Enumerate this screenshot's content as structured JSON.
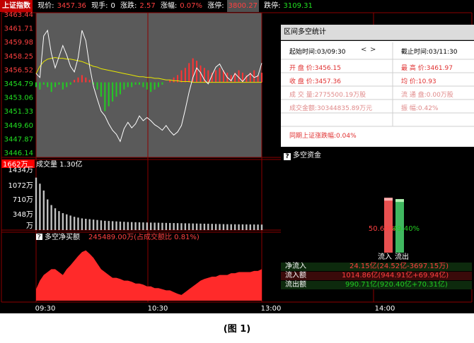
{
  "header": {
    "index_name": "上证指数",
    "current_label": "现价:",
    "current_value": "3457.36",
    "volume_label": "现手:",
    "volume_value": "0",
    "change_label": "涨跌:",
    "change_value": "2.57",
    "pct_label": "涨幅:",
    "pct_value": "0.07%",
    "limit_up_label": "涨停:",
    "limit_up_value": "3800.27",
    "limit_down_label": "跌停:",
    "limit_down_value": "3109.31"
  },
  "price_axis": {
    "ticks": [
      "3463.44",
      "3461.71",
      "3459.98",
      "3458.25",
      "3456.52",
      "3454.79",
      "3453.06",
      "3451.33",
      "3449.60",
      "3447.87",
      "3446.14"
    ]
  },
  "volume_panel": {
    "badge": "1662万",
    "title": "成交量 1.30亿",
    "ticks": [
      "1434万",
      "1072万",
      "710万",
      "348万",
      "万"
    ]
  },
  "net_panel": {
    "title_icon": "?",
    "title": "多空净买额",
    "title_value": "245489.00万(占成交额比 0.81%)"
  },
  "time_axis": {
    "labels": [
      "09:30",
      "10:30",
      "13:00",
      "14:00"
    ]
  },
  "popup": {
    "title": "区间多空统计",
    "start_time": "起始时间:03/09:30",
    "nav_prev": "<",
    "nav_next": ">",
    "end_time": "截止时间:03/11:30",
    "open": "开 盘 价:3456.15",
    "high": "最 高 价:3461.97",
    "close": "收 盘 价:3457.36",
    "avg": "均   价:10.93",
    "volume": "成 交 量:2775500.19万股",
    "float": "流 通 盘:0.00万股",
    "amount": "成交金额:30344835.89万元",
    "amplitude": "振   幅:0.42%",
    "change": "同期上证涨跌幅:0.04%",
    "section_title": "多空资金",
    "section_icon": "?",
    "bar_in_pct": "50.60%",
    "bar_out_pct": "49.40%",
    "bar_in_value": 50.6,
    "bar_out_value": 49.4,
    "bar_in_label": "流入",
    "bar_out_label": "流出",
    "rows": [
      {
        "label": "净流入",
        "value": "24.15亿(24.52亿-3697.15万)"
      },
      {
        "label": "流入额",
        "value": "1014.86亿(944.91亿+69.94亿)"
      },
      {
        "label": "流出额",
        "value": "990.71亿(920.40亿+70.31亿)"
      }
    ]
  },
  "figure_caption": "(图 1)",
  "colors": {
    "up": "#ff3333",
    "down": "#22cc22",
    "price_line": "#ffffff",
    "avg_line": "#e8e800",
    "grid": "#8b0000",
    "panel_bg": "#5a5a5a",
    "net_fill": "#ff2a2a",
    "bar_in": "#e85050",
    "bar_out": "#40b860"
  },
  "series": {
    "price": [
      3456.1,
      3455.6,
      3460.8,
      3461.5,
      3458.6,
      3456.8,
      3458.2,
      3459.6,
      3458.4,
      3457.0,
      3456.3,
      3458.1,
      3461.5,
      3460.2,
      3457.0,
      3454.5,
      3452.9,
      3451.4,
      3450.8,
      3449.8,
      3449.0,
      3448.5,
      3447.6,
      3449.2,
      3450.0,
      3449.3,
      3449.8,
      3450.8,
      3450.2,
      3450.6,
      3450.2,
      3449.7,
      3449.4,
      3449.0,
      3449.6,
      3448.9,
      3448.4,
      3448.8,
      3449.6,
      3451.6,
      3453.8,
      3455.6,
      3456.8,
      3456.2,
      3455.3,
      3454.8,
      3455.9,
      3456.9,
      3457.3,
      3456.4,
      3455.6,
      3455.2,
      3456.1,
      3455.6,
      3455.1,
      3455.7,
      3456.1,
      3455.6,
      3455.8,
      3457.4
    ],
    "avg": [
      3456.1,
      3457.0,
      3457.6,
      3457.9,
      3458.0,
      3458.1,
      3458.0,
      3458.0,
      3457.9,
      3457.9,
      3457.8,
      3457.7,
      3457.6,
      3457.4,
      3457.2,
      3457.0,
      3456.9,
      3456.7,
      3456.6,
      3456.5,
      3456.4,
      3456.3,
      3456.2,
      3456.1,
      3456.0,
      3455.9,
      3455.8,
      3455.7,
      3455.7,
      3455.6,
      3455.6,
      3455.5,
      3455.5,
      3455.4,
      3455.3,
      3455.3,
      3455.2,
      3455.2,
      3455.1,
      3455.1,
      3455.1,
      3455.0,
      3455.0,
      3455.0,
      3455.0,
      3455.0,
      3455.0,
      3455.0,
      3455.0,
      3455.0,
      3455.0,
      3455.0,
      3455.0,
      3455.0,
      3455.0,
      3455.0,
      3455.0,
      3455.0,
      3455.0,
      3455.0
    ],
    "volume": [
      1300,
      1150,
      980,
      760,
      620,
      540,
      470,
      420,
      390,
      360,
      330,
      310,
      290,
      280,
      270,
      260,
      250,
      240,
      230,
      225,
      220,
      215,
      210,
      205,
      200,
      198,
      195,
      192,
      190,
      188,
      186,
      184,
      182,
      180,
      178,
      176,
      174,
      172,
      170,
      168,
      166,
      164,
      162,
      160,
      158,
      156,
      154,
      152,
      150,
      148,
      146,
      145,
      144,
      143,
      142,
      141,
      140,
      139,
      138,
      137
    ],
    "net": [
      0.2,
      0.35,
      0.45,
      0.5,
      0.55,
      0.55,
      0.5,
      0.45,
      0.55,
      0.62,
      0.7,
      0.78,
      0.85,
      0.88,
      0.82,
      0.75,
      0.65,
      0.55,
      0.5,
      0.45,
      0.4,
      0.4,
      0.38,
      0.35,
      0.35,
      0.33,
      0.3,
      0.3,
      0.28,
      0.25,
      0.25,
      0.22,
      0.22,
      0.2,
      0.18,
      0.18,
      0.15,
      0.12,
      0.1,
      0.15,
      0.2,
      0.25,
      0.3,
      0.35,
      0.38,
      0.4,
      0.42,
      0.42,
      0.45,
      0.45,
      0.45,
      0.48,
      0.48,
      0.5,
      0.5,
      0.5,
      0.5,
      0.52,
      0.52,
      0.55
    ],
    "bars": [
      -2,
      -3,
      -1,
      -2,
      -4,
      -2,
      -1,
      -3,
      -2,
      -1,
      1,
      2,
      3,
      2,
      1,
      -1,
      -3,
      -6,
      -12,
      -10,
      -8,
      -6,
      -5,
      -3,
      -2,
      -2,
      -1,
      -1,
      -2,
      -3,
      -4,
      -3,
      -2,
      -1,
      0,
      1,
      2,
      3,
      5,
      6,
      8,
      10,
      9,
      7,
      6,
      5,
      4,
      5,
      6,
      5,
      4,
      3,
      4,
      5,
      4,
      3,
      4,
      5,
      3,
      4
    ]
  }
}
